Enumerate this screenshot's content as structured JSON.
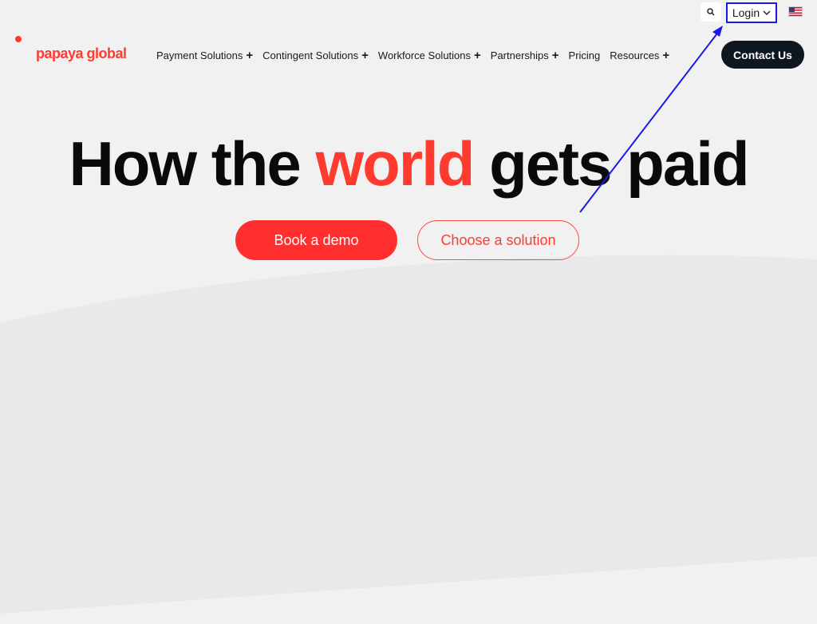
{
  "brand": {
    "name": "papaya global",
    "color": "#ff3b2f"
  },
  "topbar": {
    "login_label": "Login",
    "search_icon": "search-icon",
    "flag_icon": "us-flag-icon"
  },
  "nav": [
    {
      "label": "Payment Solutions",
      "expandable": true
    },
    {
      "label": "Contingent Solutions",
      "expandable": true
    },
    {
      "label": "Workforce Solutions",
      "expandable": true
    },
    {
      "label": "Partnerships",
      "expandable": true
    },
    {
      "label": "Pricing",
      "expandable": false
    },
    {
      "label": "Resources",
      "expandable": true
    }
  ],
  "contact_label": "Contact Us",
  "hero": {
    "pre": "How the ",
    "accent": "world",
    "post": " gets paid"
  },
  "cta": {
    "primary": "Book a demo",
    "secondary": "Choose a solution"
  },
  "annotation": {
    "color": "#1a1ae6"
  }
}
